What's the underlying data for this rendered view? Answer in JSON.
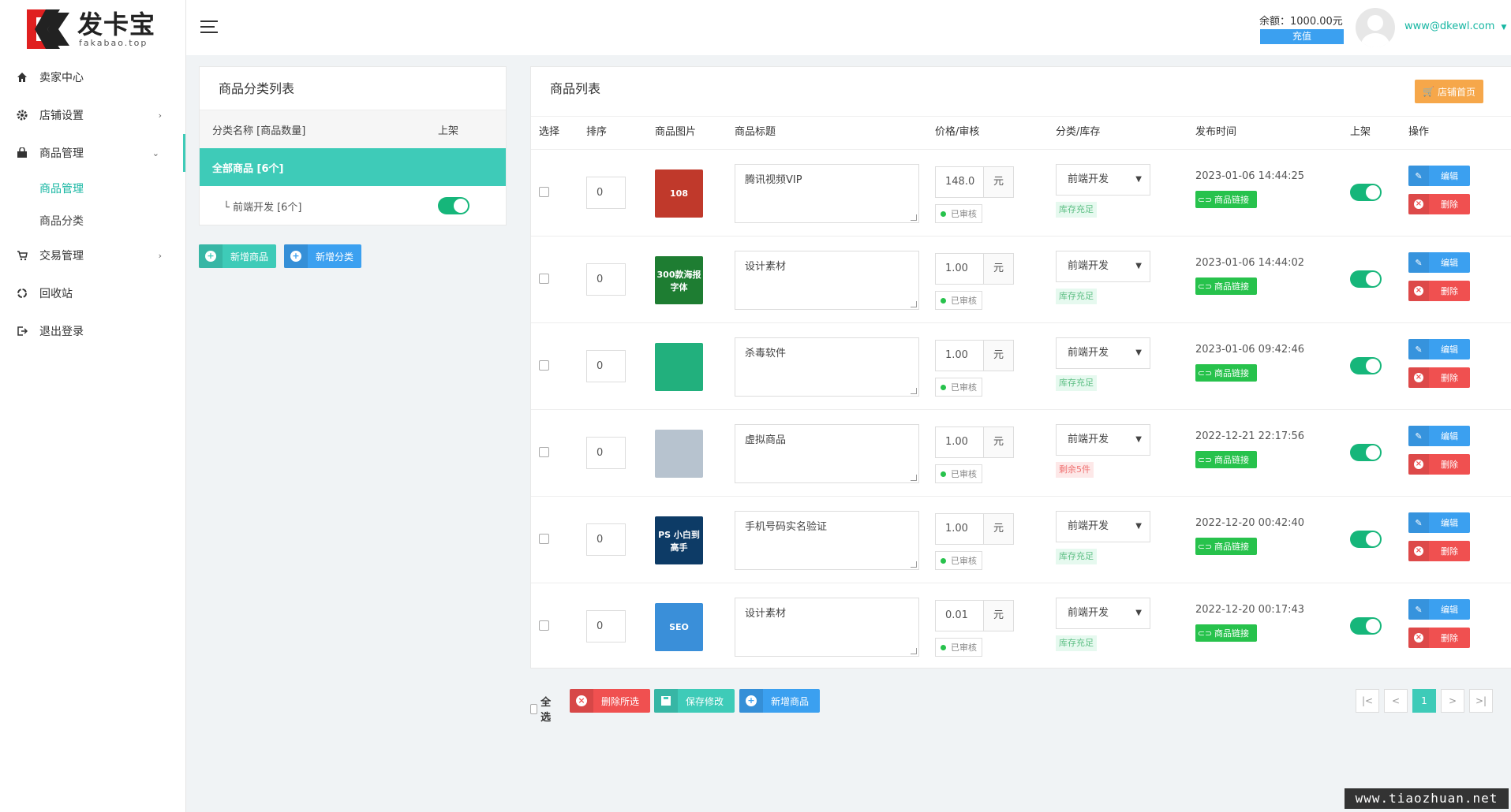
{
  "logo": {
    "title": "发卡宝",
    "subtitle": "fakabao.top"
  },
  "sidebar": {
    "items": [
      {
        "label": "卖家中心",
        "icon": "home-icon"
      },
      {
        "label": "店铺设置",
        "icon": "gear-icon"
      },
      {
        "label": "商品管理",
        "icon": "bag-icon"
      },
      {
        "label": "交易管理",
        "icon": "cart-icon"
      },
      {
        "label": "回收站",
        "icon": "recycle-icon"
      },
      {
        "label": "退出登录",
        "icon": "logout-icon"
      }
    ],
    "sub_items": [
      {
        "label": "商品管理"
      },
      {
        "label": "商品分类"
      }
    ]
  },
  "topbar": {
    "balance": "余额：1000.00元",
    "recharge": "充值",
    "email": "www@dkewl.com"
  },
  "category_panel": {
    "title": "商品分类列表",
    "col_name": "分类名称 [商品数量]",
    "col_up": "上架",
    "all": "全部商品 [6个]",
    "items": [
      {
        "label": "└ 前端开发 [6个]",
        "on": true
      }
    ],
    "add_product": "新增商品",
    "add_category": "新增分类"
  },
  "product_panel": {
    "title": "商品列表",
    "shop_home": "店铺首页",
    "headers": [
      "选择",
      "排序",
      "商品图片",
      "商品标题",
      "价格/审核",
      "分类/库存",
      "发布时间",
      "上架",
      "操作"
    ],
    "unit": "元",
    "audit": "已审核",
    "link": "商品链接",
    "edit": "编辑",
    "delete": "删除",
    "rows": [
      {
        "sort": "0",
        "title": "腾讯视频VIP",
        "price": "148.0",
        "category": "前端开发",
        "stock": "库存充足",
        "stock_low": false,
        "time": "2023-01-06 14:44:25",
        "thumb_color": "#c0392b",
        "thumb_text": "108"
      },
      {
        "sort": "0",
        "title": "设计素材",
        "price": "1.00",
        "category": "前端开发",
        "stock": "库存充足",
        "stock_low": false,
        "time": "2023-01-06 14:44:02",
        "thumb_color": "#1e7d32",
        "thumb_text": "300款海报字体"
      },
      {
        "sort": "0",
        "title": "杀毒软件",
        "price": "1.00",
        "category": "前端开发",
        "stock": "库存充足",
        "stock_low": false,
        "time": "2023-01-06 09:42:46",
        "thumb_color": "#22b07d",
        "thumb_text": ""
      },
      {
        "sort": "0",
        "title": "虚拟商品",
        "price": "1.00",
        "category": "前端开发",
        "stock": "剩余5件",
        "stock_low": true,
        "time": "2022-12-21 22:17:56",
        "thumb_color": "#b7c3cf",
        "thumb_text": ""
      },
      {
        "sort": "0",
        "title": "手机号码实名验证",
        "price": "1.00",
        "category": "前端开发",
        "stock": "库存充足",
        "stock_low": false,
        "time": "2022-12-20 00:42:40",
        "thumb_color": "#0d3b66",
        "thumb_text": "PS 小白到高手"
      },
      {
        "sort": "0",
        "title": "设计素材",
        "price": "0.01",
        "category": "前端开发",
        "stock": "库存充足",
        "stock_low": false,
        "time": "2022-12-20 00:17:43",
        "thumb_color": "#3a8fd9",
        "thumb_text": "SEO"
      }
    ]
  },
  "bottom": {
    "select_all": "全选",
    "delete_selected": "删除所选",
    "save": "保存修改",
    "add": "新增商品"
  },
  "pager": {
    "first": "|<",
    "prev": "<",
    "current": "1",
    "next": ">",
    "last": ">|"
  },
  "watermark": "www.tiaozhuan.net",
  "colors": {
    "accent": "#3ecbb8",
    "blue": "#3ba0f0",
    "red": "#f05050",
    "green": "#27c24c",
    "orange": "#f6a74a"
  }
}
